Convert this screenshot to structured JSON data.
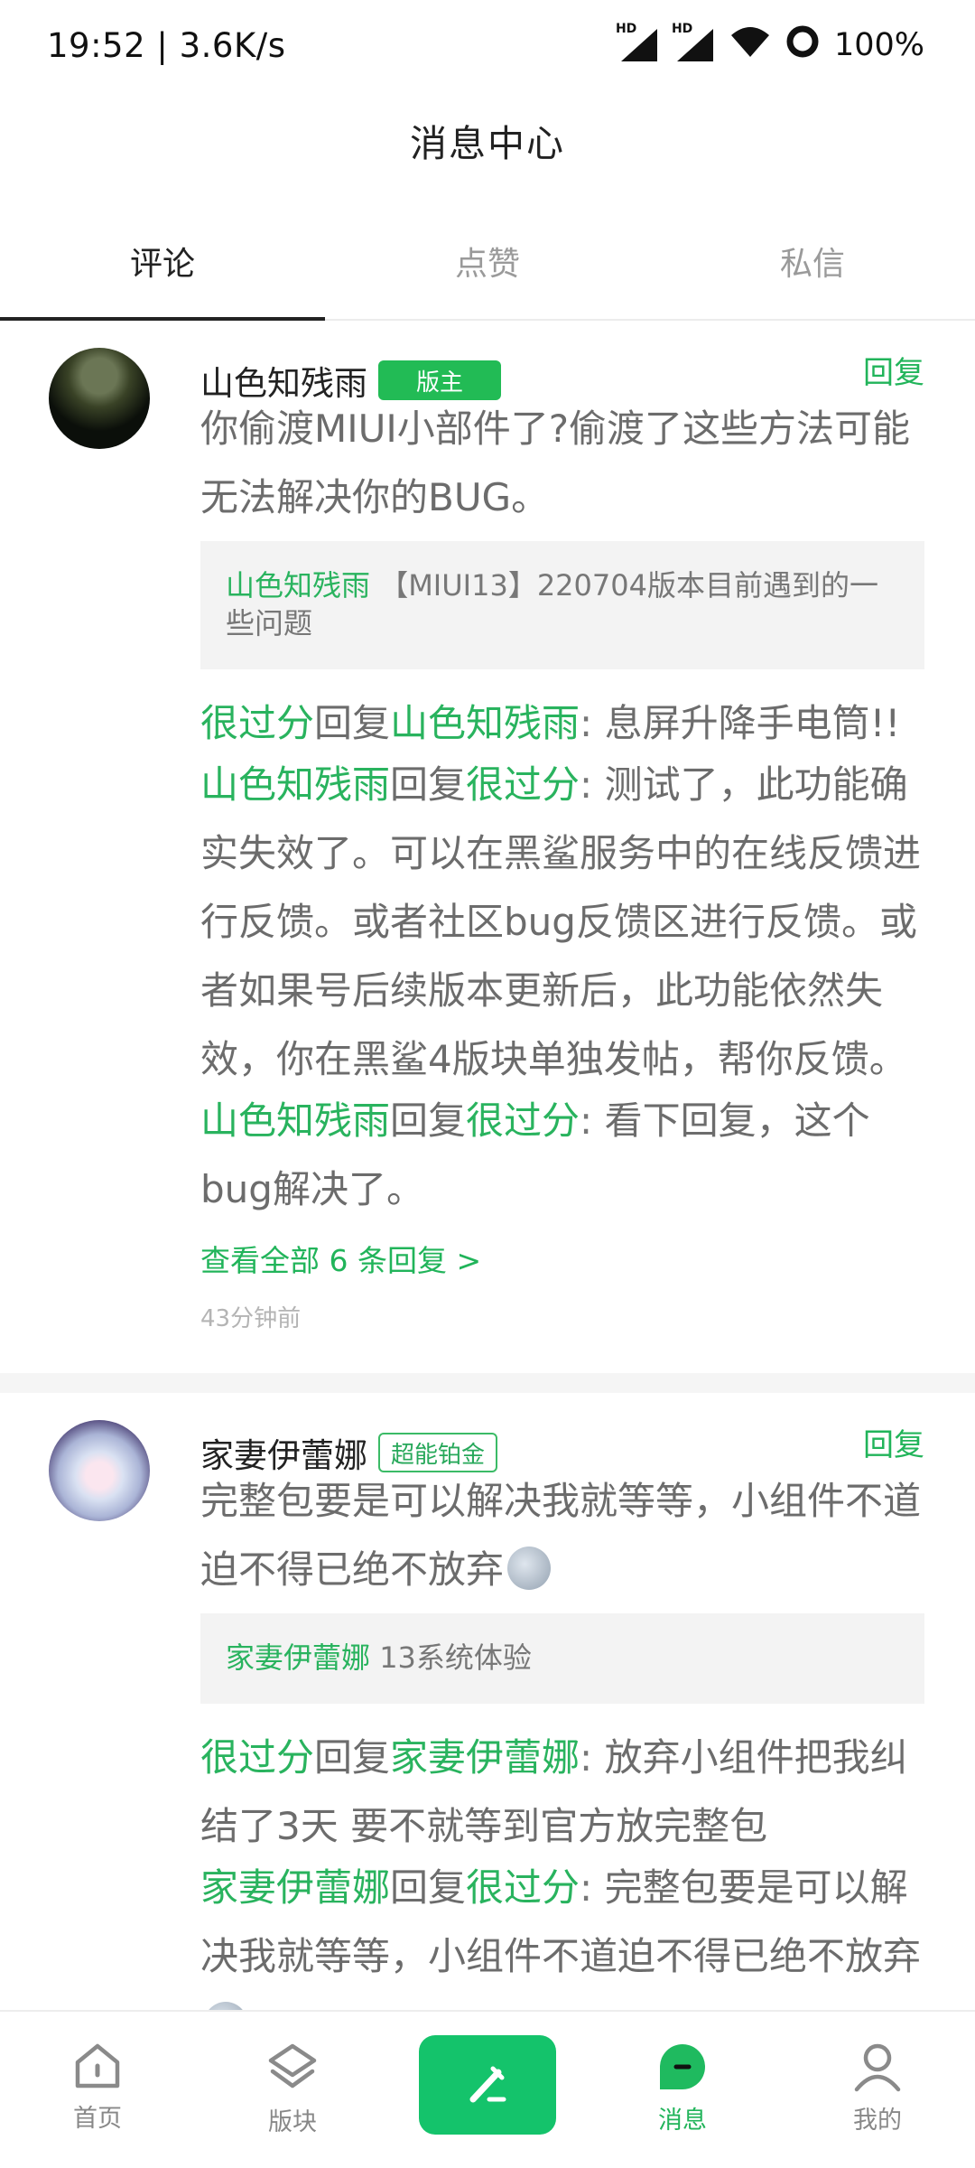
{
  "status_bar": {
    "time_speed": "19:52 | 3.6K/s",
    "battery": "100%",
    "hd_label": "HD"
  },
  "header": {
    "title": "消息中心"
  },
  "tabs": [
    {
      "label": "评论",
      "active": true
    },
    {
      "label": "点赞",
      "active": false
    },
    {
      "label": "私信",
      "active": false
    }
  ],
  "comments": [
    {
      "name": "山色知残雨",
      "badge": "版主",
      "reply_label": "回复",
      "text": "你偷渡MIUI小部件了?偷渡了这些方法可能无法解决你的BUG。",
      "quote": {
        "author": "山色知残雨",
        "text": "【MIUI13】220704版本目前遇到的一些问题"
      },
      "thread": [
        {
          "from": "很过分",
          "verb": "回复",
          "to": "山色知残雨",
          "sep": ": ",
          "text": "息屏升降手电筒!!"
        },
        {
          "from": "山色知残雨",
          "verb": "回复",
          "to": "很过分",
          "sep": ": ",
          "text": "测试了，此功能确实失效了。可以在黑鲨服务中的在线反馈进行反馈。或者社区bug反馈区进行反馈。或者如果号后续版本更新后，此功能依然失效，你在黑鲨4版块单独发帖，帮你反馈。"
        },
        {
          "from": "山色知残雨",
          "verb": "回复",
          "to": "很过分",
          "sep": ": ",
          "text": "看下回复，这个bug解决了。"
        }
      ],
      "view_all": "查看全部 6 条回复 >",
      "time": "43分钟前"
    },
    {
      "name": "家妻伊蕾娜",
      "badge": "超能铂金",
      "reply_label": "回复",
      "text": "完整包要是可以解决我就等等，小组件不道迫不得已绝不放弃",
      "quote": {
        "author": "家妻伊蕾娜",
        "text": "13系统体验"
      },
      "thread": [
        {
          "from": "很过分",
          "verb": "回复",
          "to": "家妻伊蕾娜",
          "sep": ": ",
          "text": "放弃小组件把我纠结了3天 要不就等到官方放完整包"
        },
        {
          "from": "家妻伊蕾娜",
          "verb": "回复",
          "to": "很过分",
          "sep": ": ",
          "text": "完整包要是可以解决我就等等，小组件不道迫不得已绝不放弃"
        }
      ]
    }
  ],
  "bottom_nav": [
    {
      "label": "首页",
      "icon": "home-icon"
    },
    {
      "label": "版块",
      "icon": "layers-icon"
    },
    {
      "label": "",
      "icon": "compose-icon"
    },
    {
      "label": "消息",
      "icon": "message-icon",
      "active": true
    },
    {
      "label": "我的",
      "icon": "profile-icon"
    }
  ],
  "colors": {
    "accent": "#21b45a",
    "compose_bg": "#14c36b"
  }
}
